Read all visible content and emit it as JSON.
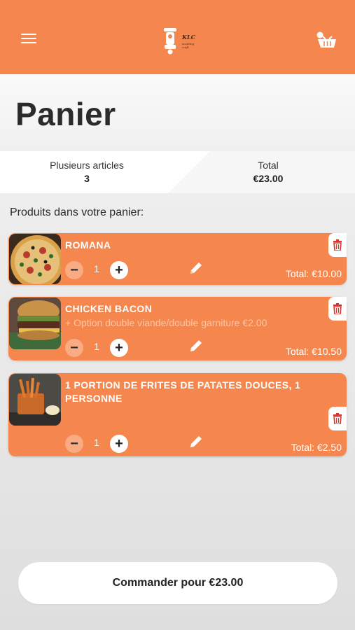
{
  "header": {
    "logo_text": "KLC",
    "logo_sub": "scooting craft",
    "brand_color": "#f5874e"
  },
  "page": {
    "title": "Panier",
    "section_label": "Produits dans votre panier:"
  },
  "summary": {
    "items_label": "Plusieurs articles",
    "items_count": "3",
    "total_label": "Total",
    "total_value": "€23.00"
  },
  "cart_items": [
    {
      "name": "ROMANA",
      "option": "",
      "quantity": "1",
      "total": "Total: €10.00",
      "image": "pizza"
    },
    {
      "name": "CHICKEN BACON",
      "option": "+ Option double viande/double garniture €2.00",
      "quantity": "1",
      "total": "Total: €10.50",
      "image": "burger"
    },
    {
      "name": "1 PORTION DE FRITES DE PATATES DOUCES, 1 PERSONNE",
      "option": "",
      "quantity": "1",
      "total": "Total: €2.50",
      "image": "fries"
    }
  ],
  "order_button": {
    "label": "Commander pour €23.00"
  },
  "icons": {
    "menu": "menu-icon",
    "cart": "basket-icon",
    "minus": "−",
    "plus": "+",
    "edit": "pencil-icon",
    "delete": "trash-icon"
  }
}
